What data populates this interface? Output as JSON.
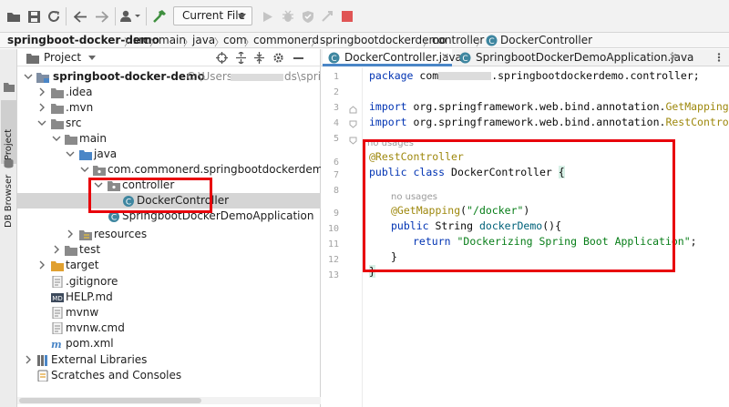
{
  "toolbar": {
    "run_config": "Current File",
    "icons": [
      "open-folder-icon",
      "save-icon",
      "sync-icon",
      "back-icon",
      "forward-icon",
      "user-icon",
      "build-hammer-icon",
      "run-icon",
      "debug-icon",
      "coverage-icon",
      "stop-icon"
    ]
  },
  "breadcrumb": [
    "springboot-docker-demo",
    "src",
    "main",
    "java",
    "com",
    "commonerd",
    "springbootdockerdemo",
    "controller",
    "DockerController"
  ],
  "side_tabs": {
    "project": "Project",
    "db_browser": "DB Browser"
  },
  "project_panel": {
    "title": "Project",
    "root_name": "springboot-docker-demo",
    "root_path_prefix": "C:\\Users",
    "root_path_suffix": "ds\\springl",
    "tree": [
      {
        "label": ".idea"
      },
      {
        "label": ".mvn"
      },
      {
        "label": "src"
      },
      {
        "label": "main"
      },
      {
        "label": "java"
      },
      {
        "label": "com.commonerd.springbootdockerdemo"
      },
      {
        "label": "controller"
      },
      {
        "label": "DockerController"
      },
      {
        "label": "SpringbootDockerDemoApplication"
      },
      {
        "label": "resources"
      },
      {
        "label": "test"
      },
      {
        "label": "target"
      },
      {
        "label": ".gitignore"
      },
      {
        "label": "HELP.md"
      },
      {
        "label": "mvnw"
      },
      {
        "label": "mvnw.cmd"
      },
      {
        "label": "pom.xml"
      },
      {
        "label": "External Libraries"
      },
      {
        "label": "Scratches and Consoles"
      }
    ]
  },
  "editor": {
    "tabs": [
      {
        "label": "DockerController.java",
        "active": true
      },
      {
        "label": "SpringbootDockerDemoApplication.java",
        "active": false
      }
    ],
    "line_numbers": [
      "1",
      "2",
      "3",
      "4",
      "5",
      "6",
      "7",
      "8",
      "9",
      "10",
      "11",
      "12",
      "13"
    ],
    "usage_hint": "no usages",
    "code": {
      "pkg_kw": "package",
      "pkg_start": "com",
      "pkg_end": ".springbootdockerdemo.controller;",
      "import_kw": "import",
      "import1_path": "org.springframework.web.bind.annotation.",
      "import1_name": "GetMapping",
      "import2_path": "org.springframework.web.bind.annotation.",
      "import2_name": "RestController",
      "semicolon": ";",
      "class_annotation": "@RestController",
      "public_kw": "public",
      "class_kw": "class",
      "class_name": "DockerController",
      "open_brace": "{",
      "method_annotation": "@GetMapping",
      "mapping_value": "\"/docker\"",
      "return_type": "String",
      "method_name": "dockerDemo",
      "method_sig_end": "(){",
      "return_kw": "return",
      "return_value": "\"Dockerizing Spring Boot Application\"",
      "close_brace": "}"
    }
  }
}
